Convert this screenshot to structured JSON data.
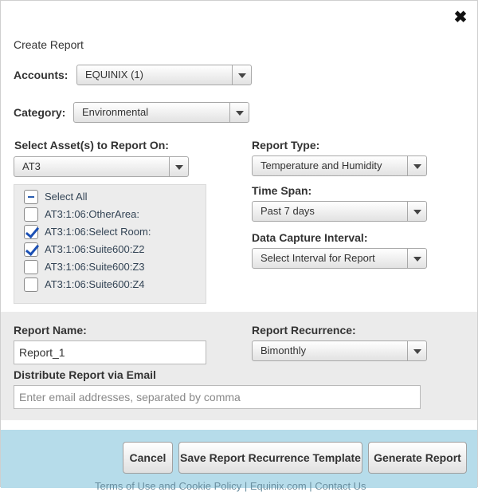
{
  "dialog": {
    "close_glyph": "✖",
    "title": "Create Report"
  },
  "accounts": {
    "label": "Accounts:",
    "value": "EQUINIX (1)"
  },
  "category": {
    "label": "Category:",
    "value": "Environmental"
  },
  "assets": {
    "label": "Select Asset(s) to Report On:",
    "value": "AT3",
    "items": [
      {
        "label": "Select All",
        "state": "partial"
      },
      {
        "label": "AT3:1:06:OtherArea:",
        "state": "unchecked"
      },
      {
        "label": "AT3:1:06:Select Room:",
        "state": "checked"
      },
      {
        "label": "AT3:1:06:Suite600:Z2",
        "state": "checked"
      },
      {
        "label": "AT3:1:06:Suite600:Z3",
        "state": "unchecked"
      },
      {
        "label": "AT3:1:06:Suite600:Z4",
        "state": "unchecked"
      }
    ]
  },
  "report_type": {
    "label": "Report Type:",
    "value": "Temperature and Humidity"
  },
  "time_span": {
    "label": "Time Span:",
    "value": "Past 7 days"
  },
  "capture_interval": {
    "label": "Data Capture Interval:",
    "value": "Select Interval for Report"
  },
  "report_name": {
    "label": "Report Name:",
    "value": "Report_1"
  },
  "recurrence": {
    "label": "Report Recurrence:",
    "value": "Bimonthly"
  },
  "email": {
    "label": "Distribute Report via Email",
    "placeholder": "Enter email addresses, separated by comma",
    "value": ""
  },
  "buttons": {
    "cancel": "Cancel",
    "save_template": "Save Report Recurrence Template",
    "generate": "Generate Report"
  },
  "footer": {
    "links": "Terms of Use and Cookie Policy  |  Equinix.com  |  Contact Us"
  },
  "colors": {
    "footer_bg": "#b6dcea",
    "band_bg": "#ebebeb",
    "check_color": "#1a4fb4"
  }
}
